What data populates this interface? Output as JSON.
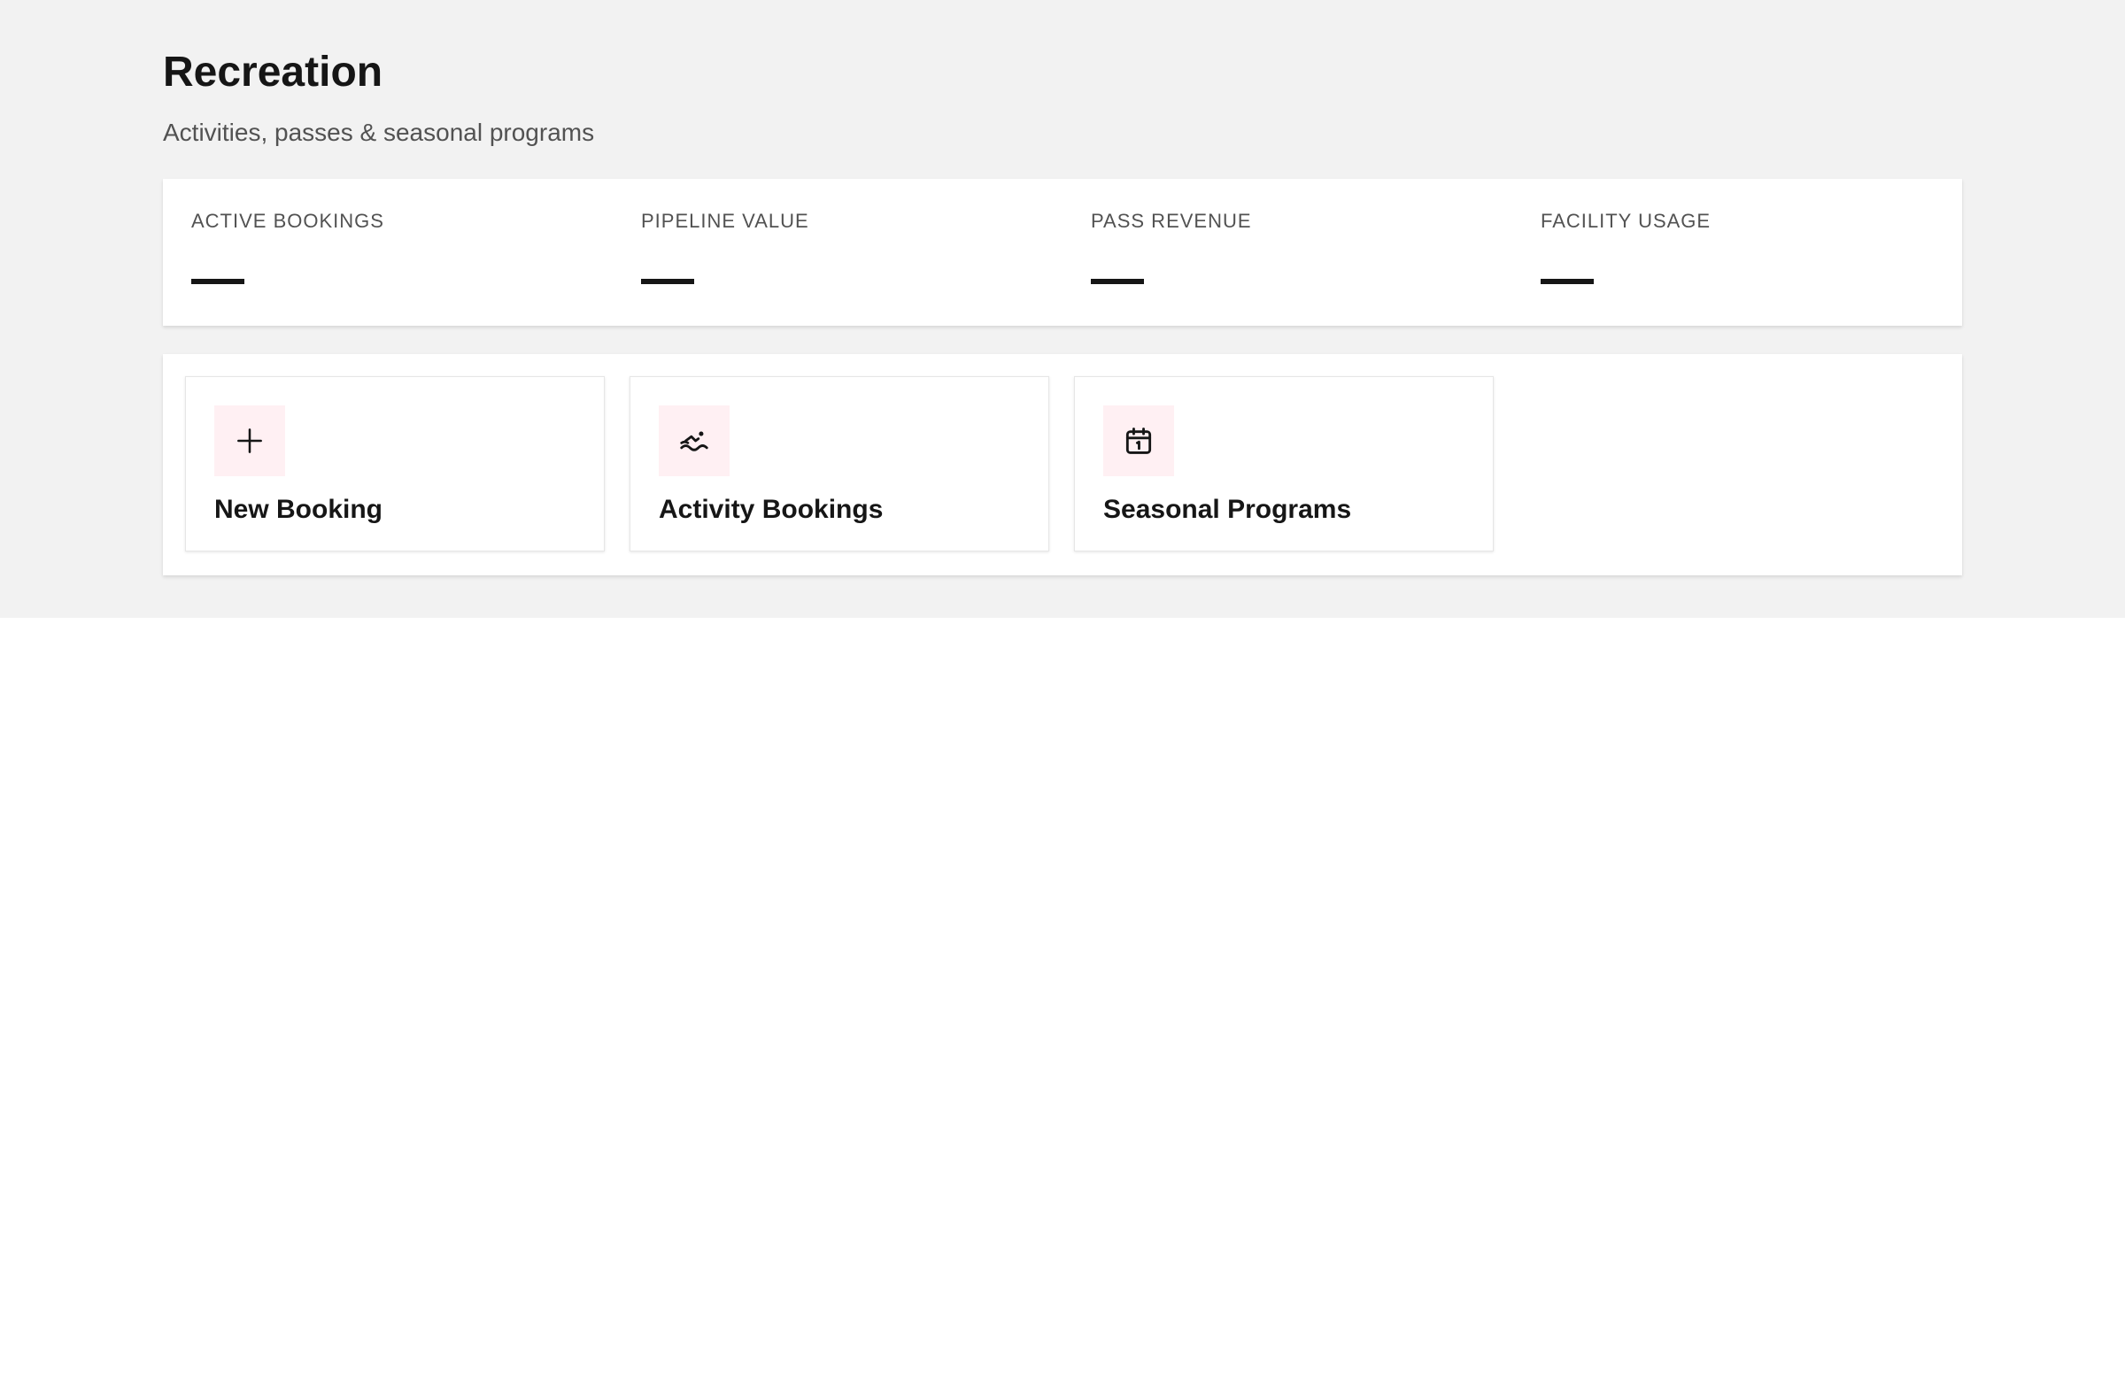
{
  "header": {
    "title": "Recreation",
    "subtitle": "Activities, passes & seasonal programs"
  },
  "kpis": [
    {
      "label": "ACTIVE BOOKINGS",
      "value": "—"
    },
    {
      "label": "PIPELINE VALUE",
      "value": "—"
    },
    {
      "label": "PASS REVENUE",
      "value": "—"
    },
    {
      "label": "FACILITY USAGE",
      "value": "—"
    }
  ],
  "actions": [
    {
      "label": "New Booking",
      "icon": "plus-icon"
    },
    {
      "label": "Activity Bookings",
      "icon": "swimmer-icon"
    },
    {
      "label": "Seasonal Programs",
      "icon": "calendar-icon"
    }
  ],
  "colors": {
    "background": "#f2f2f2",
    "panel": "#ffffff",
    "icon_tile": "#fff0f3",
    "text_primary": "#161616",
    "text_secondary": "#525252"
  }
}
